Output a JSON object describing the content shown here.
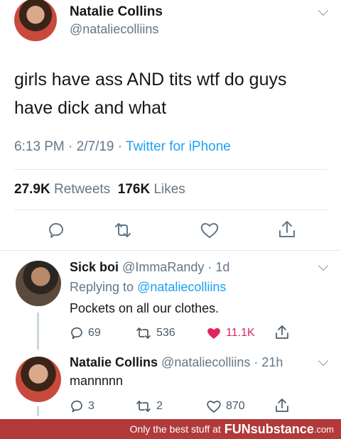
{
  "main_tweet": {
    "author_name": "Natalie Collins",
    "author_handle": "@nataliecolliins",
    "text": "girls have ass AND tits wtf do guys have dick and what",
    "time": "6:13 PM",
    "date": "2/7/19",
    "client": "Twitter for iPhone",
    "retweets_count": "27.9K",
    "retweets_label": "Retweets",
    "likes_count": "176K",
    "likes_label": "Likes"
  },
  "replies": [
    {
      "author_name": "Sick boi",
      "author_handle": "@ImmaRandy",
      "age": "1d",
      "replying_prefix": "Replying to",
      "replying_to": "@nataliecolliins",
      "text": "Pockets on all our clothes.",
      "reply_count": "69",
      "retweet_count": "536",
      "like_count": "11.1K",
      "liked": true
    },
    {
      "author_name": "Natalie Collins",
      "author_handle": "@nataliecolliins",
      "age": "21h",
      "text": "mannnnn",
      "reply_count": "3",
      "retweet_count": "2",
      "like_count": "870",
      "liked": false
    }
  ],
  "footer": {
    "tagline": "Only the best stuff at",
    "brand": "FUNsubstance",
    "tld": ".com"
  },
  "colors": {
    "link": "#1da1f2",
    "secondary_text": "#657786",
    "like_active": "#e0245e",
    "footer_bg": "#b23a3a"
  }
}
